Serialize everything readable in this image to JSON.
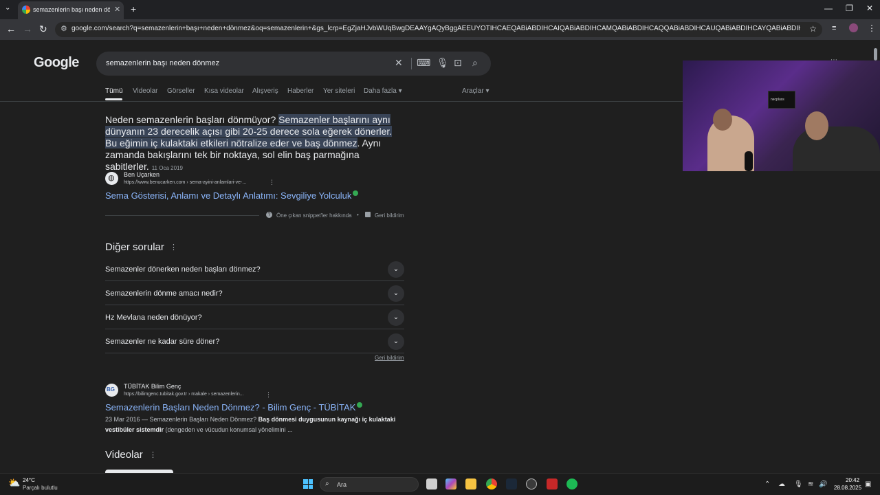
{
  "browser": {
    "tab_title": "semazenlerin başı neden dönmez",
    "url": "google.com/search?q=semazenlerin+başı+neden+dönmez&oq=semazenlerin+&gs_lcrp=EgZjaHJvbWUqBwgDEAAYgAQyBggAEEUYOTIHCAEQABiABDIHCAIQABiABDIHCAMQABiABDIHCAQQABiABDIHCAUQABiABDIHCAYQABiABDIHCAcQABiABDIHCAgQABi..."
  },
  "google": {
    "logo": "Google",
    "query": "semazenlerin başı neden dönmez",
    "tabs": [
      "Tümü",
      "Videolar",
      "Görseller",
      "Kısa videolar",
      "Alışveriş",
      "Haberler",
      "Yer siteleri",
      "Daha fazla"
    ],
    "tools": "Araçlar"
  },
  "featured": {
    "text_plain_1": "Neden semazenlerin başları dönmüyor? ",
    "text_hl_1": "Semazenler başlarını aynı dünyanın 23 derecelik açısı gibi 20-25 derece sola eğerek dönerler.",
    "text_plain_2": " ",
    "text_hl_2": "Bu eğimin iç kulaktaki etkileri nötralize eder ve baş dönmez",
    "text_plain_3": ". Aynı zamanda bakışlarını tek bir noktaya, sol elin baş parmağına sabitlerler.",
    "date": "11 Oca 2019",
    "source_name": "Ben Uçarken",
    "source_url": "https://www.benucarken.com › sema-ayini-anlamlari-ve-...",
    "link": "Sema Gösterisi, Anlamı ve Detaylı Anlatımı: Sevgiliye Yolculuk",
    "about": "Öne çıkan snippet'ler hakkında",
    "feedback": "Geri bildirim"
  },
  "paa": {
    "title": "Diğer sorular",
    "questions": [
      "Semazenler dönerken neden başları dönmez?",
      "Semazenlerin dönme amacı nedir?",
      "Hz Mevlana neden dönüyor?",
      "Semazenler ne kadar süre döner?"
    ],
    "feedback": "Geri bildirim"
  },
  "result2": {
    "source_name": "TÜBİTAK Bilim Genç",
    "source_url": "https://bilimgenc.tubitak.gov.tr › makale › semazenlerin...",
    "link": "Semazenlerin Başları Neden Dönmez? - Bilim Genç - TÜBİTAK",
    "date": "23 Mar 2016",
    "snippet_a": " — Semazenlerin Başları Neden Dönmez? ",
    "snippet_b": "Baş dönmesi duygusunun kaynağı iç kulaktaki vestibüler sistemdir",
    "snippet_c": " (dengeden ve vücudun konumsal yönelimini ..."
  },
  "videos": {
    "title": "Videolar"
  },
  "cam": {
    "tv_text": "necpluss"
  },
  "taskbar": {
    "temp": "24°C",
    "weather": "Parçalı bulutlu",
    "search": "Ara",
    "time": "20:42",
    "date": "28.08.2025"
  },
  "colors": {
    "link": "#8ab4f8",
    "highlight": "#394457",
    "bg": "#1f1f1f"
  }
}
